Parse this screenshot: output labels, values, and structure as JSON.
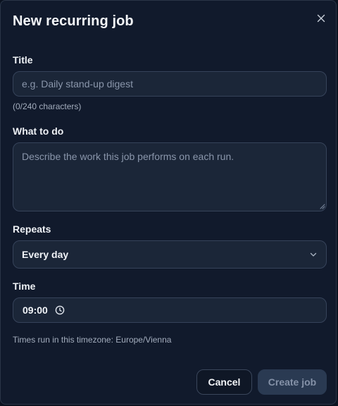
{
  "dialog": {
    "title": "New recurring job",
    "close_icon": "close-icon"
  },
  "title_field": {
    "label": "Title",
    "value": "",
    "placeholder": "e.g. Daily stand-up digest",
    "char_count": "(0/240 characters)"
  },
  "what_field": {
    "label": "What to do",
    "value": "",
    "placeholder": "Describe the work this job performs on each run."
  },
  "repeats_field": {
    "label": "Repeats",
    "selected": "Every day",
    "icon": "chevron-down-icon"
  },
  "time_field": {
    "label": "Time",
    "value": "09:00",
    "icon": "clock-icon",
    "timezone_note": "Times run in this timezone: Europe/Vienna"
  },
  "actions": {
    "cancel_label": "Cancel",
    "create_label": "Create job"
  },
  "colors": {
    "background": "#111a2c",
    "field_bg": "#1b2638",
    "border": "#36435a",
    "primary_disabled": "#2a3a52"
  }
}
